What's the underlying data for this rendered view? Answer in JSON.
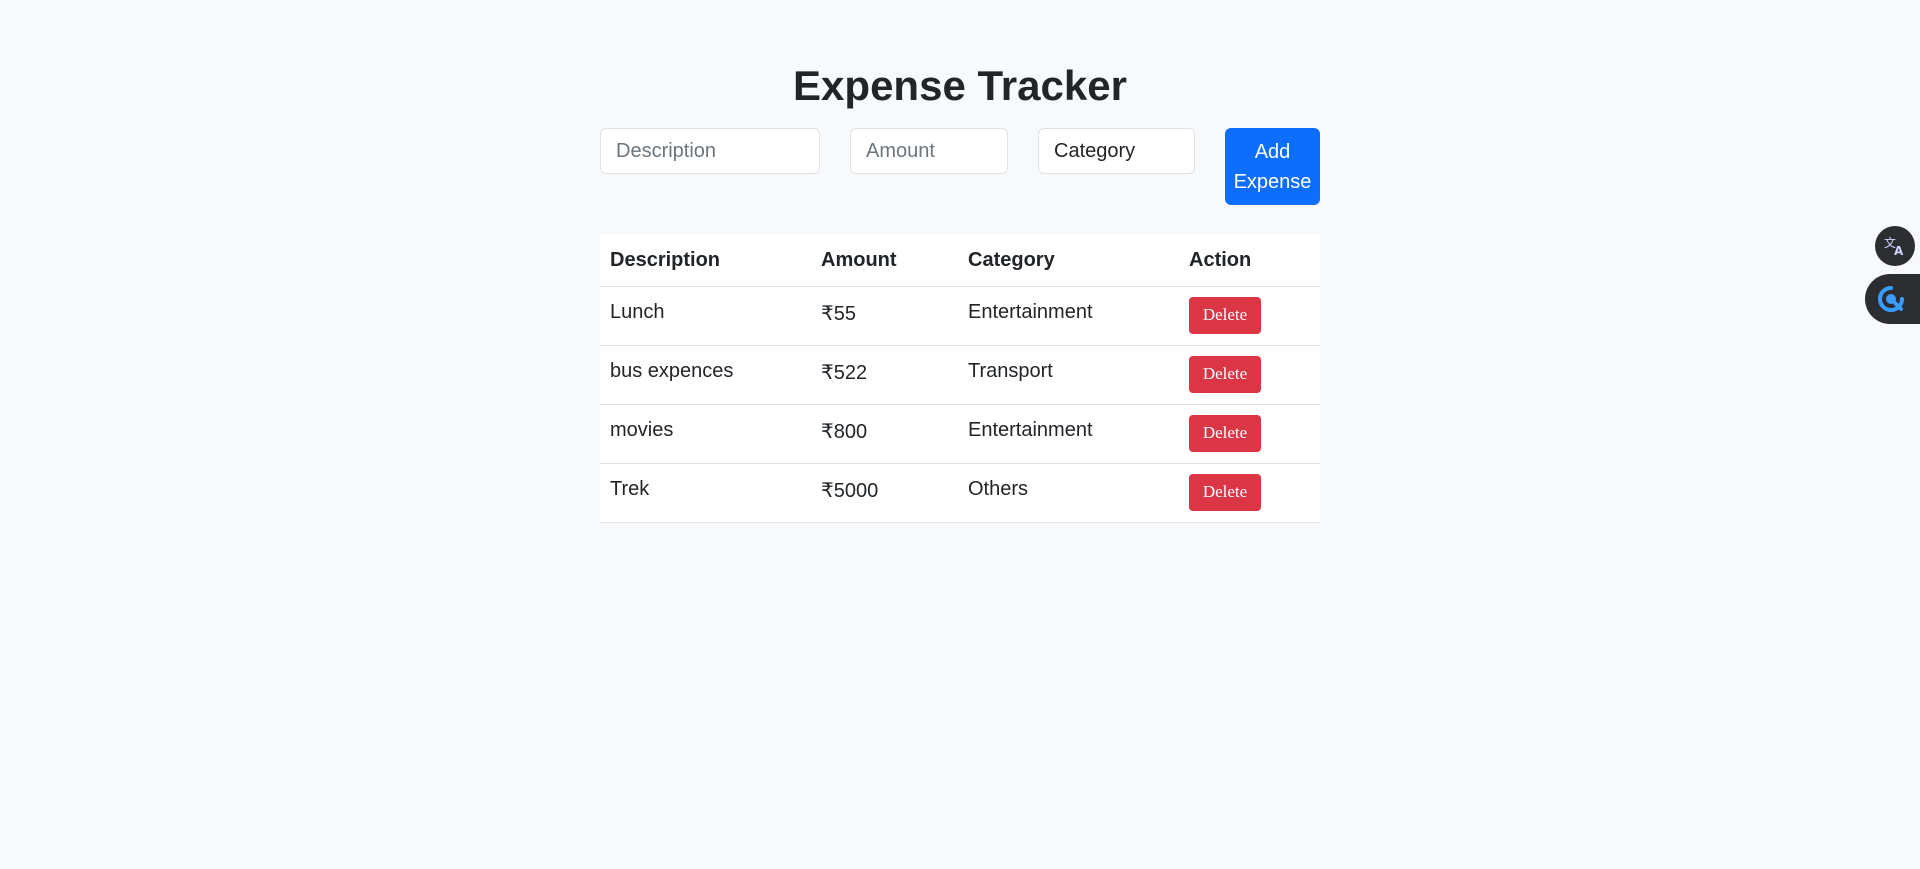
{
  "page": {
    "title": "Expense Tracker"
  },
  "form": {
    "description_placeholder": "Description",
    "description_value": "",
    "amount_placeholder": "Amount",
    "amount_value": "",
    "category_selected": "Category",
    "add_button_line1": "Add",
    "add_button_line2": "Expense"
  },
  "table": {
    "headers": [
      "Description",
      "Amount",
      "Category",
      "Action"
    ],
    "rows": [
      {
        "description": "Lunch",
        "amount": "₹55",
        "category": "Entertainment",
        "action": "Delete"
      },
      {
        "description": "bus expences",
        "amount": "₹522",
        "category": "Transport",
        "action": "Delete"
      },
      {
        "description": "movies",
        "amount": "₹800",
        "category": "Entertainment",
        "action": "Delete"
      },
      {
        "description": "Trek",
        "amount": "₹5000",
        "category": "Others",
        "action": "Delete"
      }
    ]
  },
  "floating_widgets": {
    "translate_icon": "translate-icon",
    "tool_icon": "assistant-tool-icon"
  },
  "colors": {
    "primary": "#0d6efd",
    "danger": "#dc3545",
    "background": "#f8f9fa",
    "text": "#212529"
  }
}
